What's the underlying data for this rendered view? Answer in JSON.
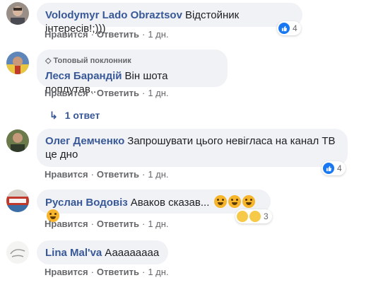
{
  "comments": [
    {
      "author": "Volodymyr Lado Obraztsov",
      "text": "Відстойник інтересів!;)))",
      "actions": {
        "like": "Нравится",
        "reply": "Ответить",
        "time": "1 дн."
      },
      "reactions": {
        "count": "4",
        "types": [
          "like-icon"
        ]
      }
    },
    {
      "badge": "Топовый поклонник",
      "author": "Леся Барандій",
      "text": "Він шота поплутав...",
      "actions": {
        "like": "Нравится",
        "reply": "Ответить",
        "time": "1 дн."
      },
      "replies": "1 ответ"
    },
    {
      "author": "Олег Демченко",
      "text": "Запрошувати цього невігласа на канал ТВ це дно",
      "actions": {
        "like": "Нравится",
        "reply": "Ответить",
        "time": "1 дн."
      },
      "reactions": {
        "count": "4",
        "types": [
          "like-icon"
        ]
      }
    },
    {
      "author": "Руслан Водовіз",
      "text": "Аваков сказав...",
      "emojis": [
        "astonished-face",
        "grinning-face",
        "grinning-face",
        "grinning-face"
      ],
      "actions": {
        "like": "Нравится",
        "reply": "Ответить",
        "time": "1 дн."
      },
      "reactions": {
        "count": "3",
        "types": [
          "haha-icon",
          "wow-icon"
        ]
      }
    },
    {
      "author": "Lina Mal'va",
      "text": "Ааааааааа",
      "actions": {
        "like": "Нравится",
        "reply": "Ответить",
        "time": "1 дн."
      }
    }
  ],
  "colors": {
    "like_blue": "#1877f2",
    "bubble": "#f0f2f5",
    "author": "#385898"
  }
}
